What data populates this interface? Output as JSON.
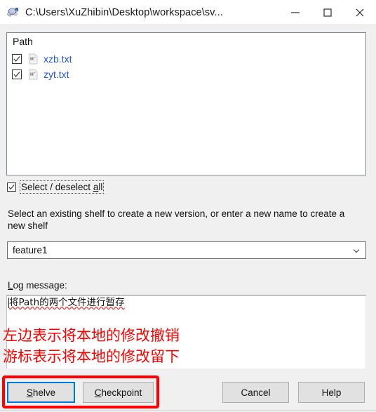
{
  "window": {
    "title": "C:\\Users\\XuZhibin\\Desktop\\workspace\\sv...",
    "app_icon": "tortoise-svn-icon",
    "controls": {
      "minimize": "minimize-icon",
      "maximize": "maximize-icon",
      "close": "close-icon"
    },
    "bg_color": "#f0f0f0",
    "titlebar_color": "#ffffff"
  },
  "filelist": {
    "column_header": "Path",
    "rows": [
      {
        "checked": true,
        "icon": "modified-file-icon",
        "path": "xzb.txt",
        "color": "#2255cc"
      },
      {
        "checked": true,
        "icon": "modified-file-icon",
        "path": "zyt.txt",
        "color": "#2255cc"
      }
    ]
  },
  "select_all": {
    "checked": true,
    "label_before": "Select / deselect ",
    "label_accel": "a",
    "label_after": "ll",
    "focused": true
  },
  "shelf": {
    "description": "Select an existing shelf to create a new version, or enter a new name to create a new shelf",
    "combo_value": "feature1",
    "combo_arrow": "chevron-down-icon"
  },
  "log": {
    "label_accel": "L",
    "label_after": "og message:",
    "message": "将Path的两个文件进行暂存",
    "spellcheck_color": "#e04a4a"
  },
  "annotations": {
    "color": "#ff0000",
    "line1": "左边表示将本地的修改撤销",
    "line2": "游标表示将本地的修改留下",
    "highlight_box": "red-rectangle-around-shelve-and-checkpoint"
  },
  "buttons": {
    "shelve": {
      "accel": "S",
      "rest": "helve",
      "default": true,
      "focus_color": "#0078d7"
    },
    "checkpoint": {
      "accel": "C",
      "rest": "heckpoint",
      "default": false
    },
    "cancel": {
      "label": "Cancel"
    },
    "help": {
      "label": "Help"
    }
  }
}
